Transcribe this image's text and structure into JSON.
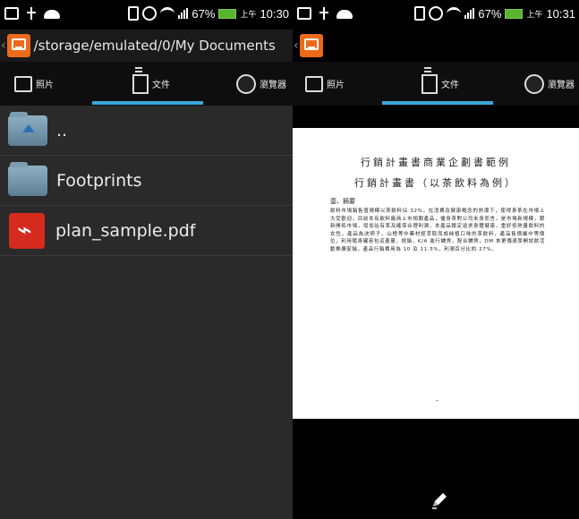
{
  "left_screen": {
    "status_bar": {
      "left_icons": [
        "gallery-icon",
        "usb-icon",
        "android-icon"
      ],
      "right_icons": [
        "vibrate-icon",
        "alarm-icon",
        "wifi-icon",
        "signal-icon"
      ],
      "battery": "67%",
      "ampm": "上午",
      "time": "10:30"
    },
    "path": "/storage/emulated/0/My Documents",
    "tabs": [
      {
        "label": "照片",
        "icon": "photo-icon",
        "selected": false
      },
      {
        "label": "文件",
        "icon": "document-icon",
        "selected": true
      },
      {
        "label": "瀏覽器",
        "icon": "browser-icon",
        "selected": false
      }
    ],
    "files": [
      {
        "name": "..",
        "icon": "folder-up-icon"
      },
      {
        "name": "Footprints",
        "icon": "folder-icon"
      },
      {
        "name": "plan_sample.pdf",
        "icon": "pdf-icon"
      }
    ]
  },
  "right_screen": {
    "status_bar": {
      "left_icons": [
        "gallery-icon",
        "usb-icon",
        "android-icon"
      ],
      "right_icons": [
        "vibrate-icon",
        "alarm-icon",
        "wifi-icon",
        "signal-icon"
      ],
      "battery": "67%",
      "ampm": "上午",
      "time": "10:31"
    },
    "tabs": [
      {
        "label": "照片",
        "icon": "photo-icon",
        "selected": false
      },
      {
        "label": "文件",
        "icon": "document-icon",
        "selected": true
      },
      {
        "label": "瀏覽器",
        "icon": "browser-icon",
        "selected": false
      }
    ],
    "document": {
      "title": "行銷計畫書商業企劃書範例",
      "subtitle": "行銷計畫書（以茶飲料為例）",
      "section": "壹、摘要",
      "body": "飲料市場銷售值規模以茶飲料佔 32%，在消費及健康概念的熱潮下，使得身茶在市場上大受歡迎，目前本有飲料廠商上市相關產品，優身茶對公司未身而言，是市場新規模，跟新開拓市場，增加站有率及確保合理利潤，本產品鎖定追求身體健康，重好低熱量飲料的女性，產品為決明子，山楂等中藥材經萃取而成純植口味的茶飲料，產品售價屬中等價位，利用隨身罐容包這產量，經銷，K/A 進行舖貨，配合鋪貨，DM 來更傳達學開試飲活動推廣促銷，產品行銷費用為 10 及 11.5%，利潤百分比約 27%。",
      "page_mark": "-"
    },
    "edit_icon": "pencil-icon"
  },
  "colors": {
    "accent": "#3aa8d8",
    "app_icon": "#ec6a1a",
    "pdf_red": "#d52b1e",
    "battery": "#58b530"
  }
}
